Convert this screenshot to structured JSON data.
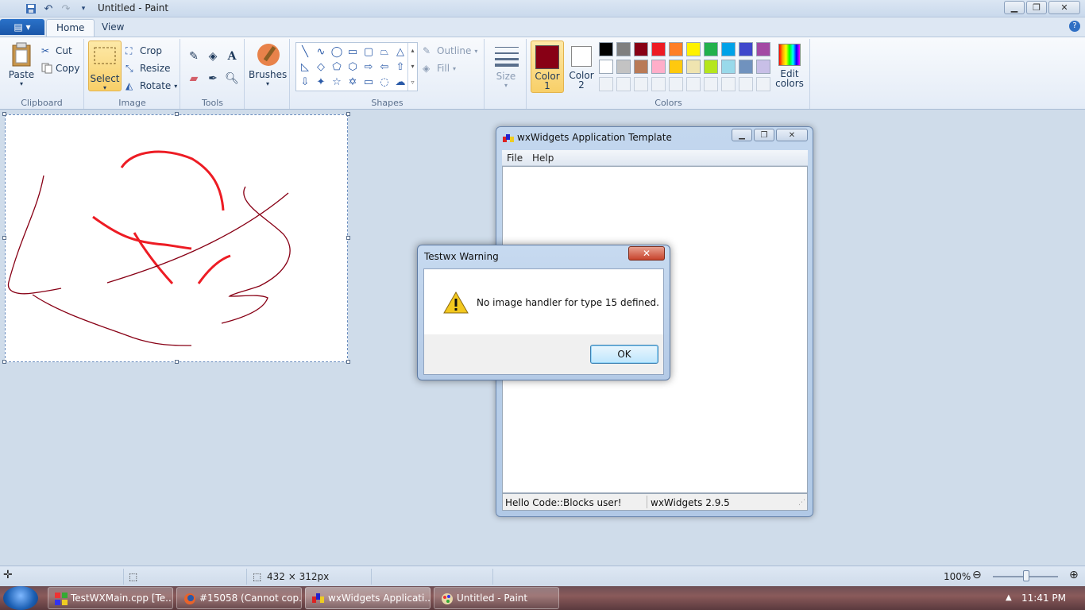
{
  "titlebar": {
    "title": "Untitled - Paint"
  },
  "tabs": [
    {
      "label": "Home"
    },
    {
      "label": "View"
    }
  ],
  "clipboard": {
    "paste": "Paste",
    "cut": "Cut",
    "copy": "Copy",
    "group": "Clipboard"
  },
  "image": {
    "select": "Select",
    "crop": "Crop",
    "resize": "Resize",
    "rotate": "Rotate",
    "group": "Image"
  },
  "tools": {
    "group": "Tools"
  },
  "brushes": {
    "label": "Brushes"
  },
  "shapes": {
    "outline": "Outline",
    "fill": "Fill",
    "group": "Shapes"
  },
  "size": {
    "label": "Size"
  },
  "colors": {
    "color1_label": "Color 1",
    "color2_label": "Color 2",
    "edit_label": "Edit colors",
    "group": "Colors",
    "color1": "#880015",
    "color2": "#ffffff",
    "palette_row1": [
      "#000000",
      "#7f7f7f",
      "#880015",
      "#ed1c24",
      "#ff7f27",
      "#fff200",
      "#22b14c",
      "#00a2e8",
      "#3f48cc",
      "#a349a4"
    ],
    "palette_row2": [
      "#ffffff",
      "#c3c3c3",
      "#b97a57",
      "#ffaec9",
      "#ffc90e",
      "#efe4b0",
      "#b5e61d",
      "#99d9ea",
      "#7092be",
      "#c8bfe7"
    ]
  },
  "wxwindow": {
    "title": "wxWidgets Application Template",
    "menu": [
      "File",
      "Help"
    ],
    "status_left": "Hello Code::Blocks user!",
    "status_right": "wxWidgets 2.9.5"
  },
  "dialog": {
    "title": "Testwx Warning",
    "message": "No image handler for type 15 defined.",
    "ok": "OK"
  },
  "statusbar": {
    "dimensions": "432 × 312px",
    "zoom": "100%"
  },
  "taskbar": {
    "items": [
      "TestWXMain.cpp [Te...",
      "#15058 (Cannot cop...",
      "wxWidgets Applicati...",
      "Untitled - Paint"
    ],
    "clock": "11:41 PM"
  }
}
